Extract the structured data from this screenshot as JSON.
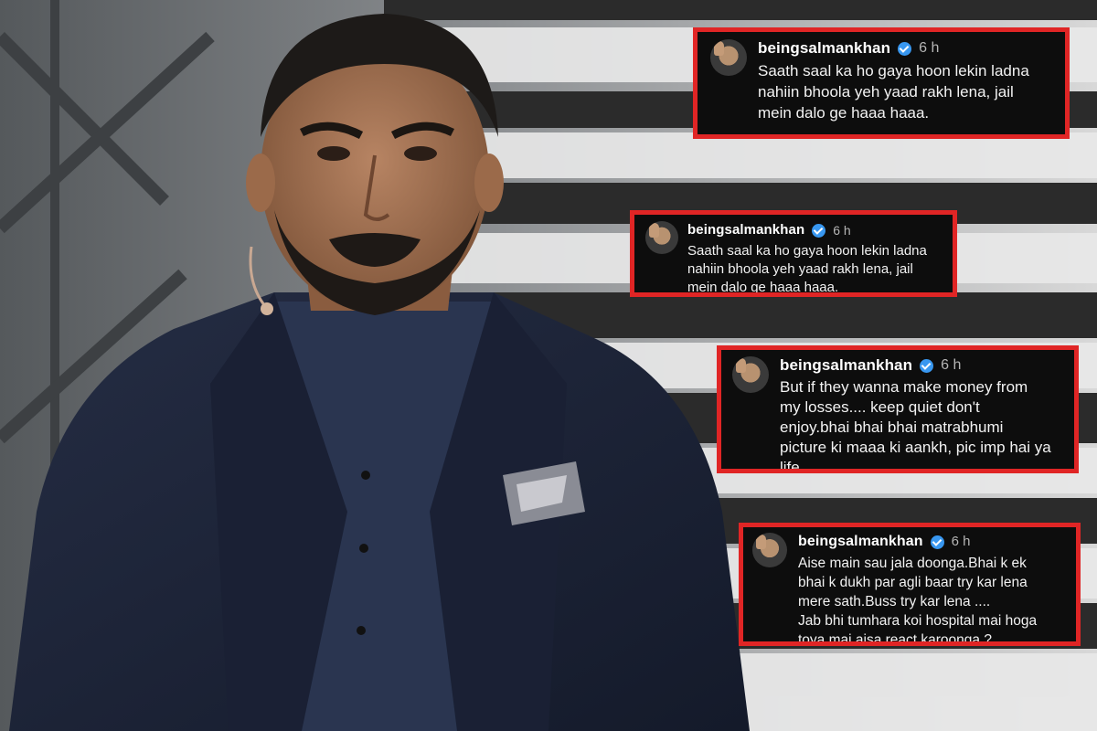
{
  "comments": [
    {
      "username": "beingsalmankhan",
      "time": "6 h",
      "text": "Saath saal ka ho gaya hoon lekin ladna\nnahiin bhoola yeh yaad rakh lena, jail\nmein dalo ge haaa haaa."
    },
    {
      "username": "beingsalmankhan",
      "time": "6 h",
      "text": "Saath saal ka ho gaya hoon lekin ladna\nnahiin bhoola yeh yaad rakh lena, jail\nmein dalo ge haaa haaa."
    },
    {
      "username": "beingsalmankhan",
      "time": "6 h",
      "text": "But  if they wanna make money from\nmy losses.... keep quiet don't\nenjoy.bhai bhai bhai matrabhumi\npicture ki maaa ki aankh, pic imp hai ya\nlife"
    },
    {
      "username": "beingsalmankhan",
      "time": "6 h",
      "text": "Aise main sau jala doonga.Bhai k ek\nbhai k dukh par agli baar try kar lena\nmere sath.Buss try kar lena ....\nJab bhi tumhara koi hospital mai hoga\ntoya mai aisa react karoonga ?"
    }
  ],
  "colors": {
    "card_border": "#e02525",
    "card_background": "#0d0d0d",
    "verified_badge": "#3897f0",
    "suit": "#1c2336",
    "shirt": "#2a3550"
  }
}
